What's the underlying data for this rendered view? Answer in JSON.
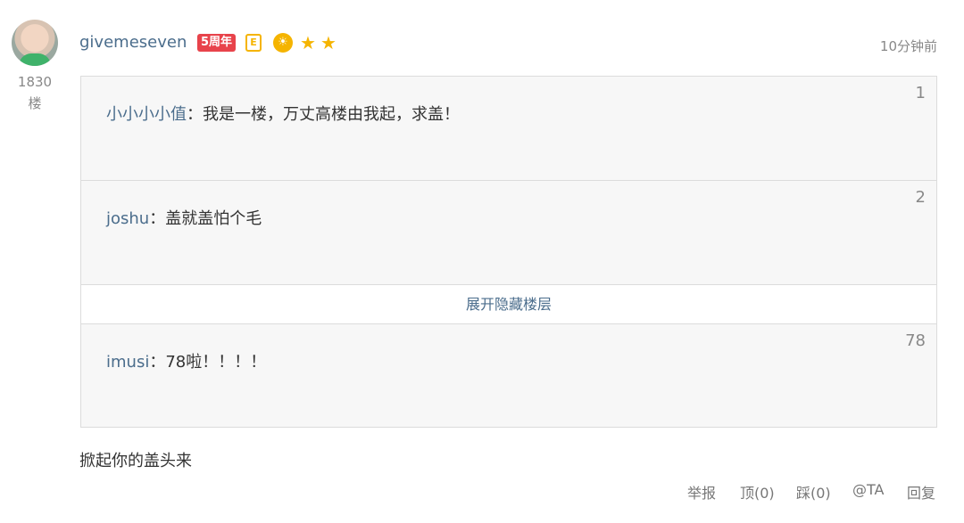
{
  "comment": {
    "floor_number": "1830",
    "floor_unit": "楼",
    "username": "givemeseven",
    "badges": {
      "anniversary": "5周年",
      "doc": "E",
      "medal_icon": "medal-icon",
      "stars": [
        "★",
        "★"
      ]
    },
    "timestamp": "10分钟前",
    "reply_text": "掀起你的盖头来"
  },
  "quotes": [
    {
      "name": "小小小小值",
      "separator": "：",
      "text": "我是一楼，万丈高楼由我起，求盖！",
      "index": "1"
    },
    {
      "name": "joshu",
      "separator": "：",
      "text": "盖就盖怕个毛",
      "index": "2"
    },
    {
      "name": "imusi",
      "separator": "：",
      "text": "78啦！！！！",
      "index": "78"
    }
  ],
  "expand_label": "展开隐藏楼层",
  "actions": {
    "report": "举报",
    "up": "顶(0)",
    "down": "踩(0)",
    "at": "@TA",
    "reply": "回复"
  },
  "colors": {
    "link": "#4b6d8c",
    "badge_red": "#e8434b",
    "star_gold": "#f5b400"
  }
}
